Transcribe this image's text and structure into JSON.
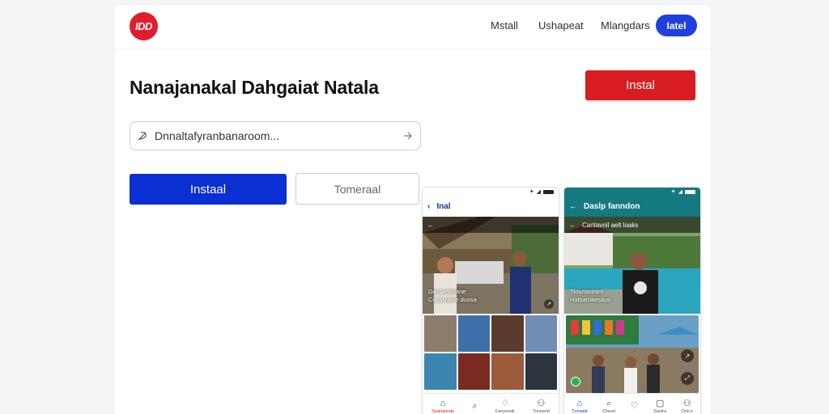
{
  "header": {
    "logo_text": "IDD",
    "nav": [
      "Mstall",
      "Ushapeat",
      "Mlangdars"
    ],
    "cta": "Iatel"
  },
  "hero": {
    "title": "Nanajanakal Dahgaiat Natala",
    "install_button": "Instal"
  },
  "search": {
    "value": "Dnnaltafyranbanaroom..."
  },
  "actions": {
    "primary": "Instaal",
    "secondary": "Tomeraal"
  },
  "phone_left": {
    "app_title": "Inal",
    "hero_caption_line1": "Dassanddane",
    "hero_caption_line2": "Cusssraine dussa",
    "tabs": [
      {
        "icon": "⌂",
        "label": "Seanannak",
        "active": true
      },
      {
        "icon": "⌕",
        "label": "",
        "active": false
      },
      {
        "icon": "♢",
        "label": "Faossoak",
        "active": false
      },
      {
        "icon": "⚇",
        "label": "Tonsand",
        "active": false
      }
    ]
  },
  "phone_right": {
    "app_title": "Daslp fanndon",
    "sub_title": "Cantavnil aelt loaks",
    "hero_caption_line1": "Tlounasiranl",
    "hero_caption_line2": "Hatsarnkesaus",
    "tabs": [
      {
        "icon": "⌂",
        "label": "Tunsaid",
        "active": true
      },
      {
        "icon": "⌕",
        "label": "Clissel",
        "active": false
      },
      {
        "icon": "♡",
        "label": "",
        "active": false
      },
      {
        "icon": "▢",
        "label": "Sastra",
        "active": false
      },
      {
        "icon": "⚇",
        "label": "Onlcs",
        "active": false
      }
    ]
  },
  "colors": {
    "brand_red": "#d91c1f",
    "brand_blue": "#0a2fd4",
    "teal": "#147a80"
  }
}
